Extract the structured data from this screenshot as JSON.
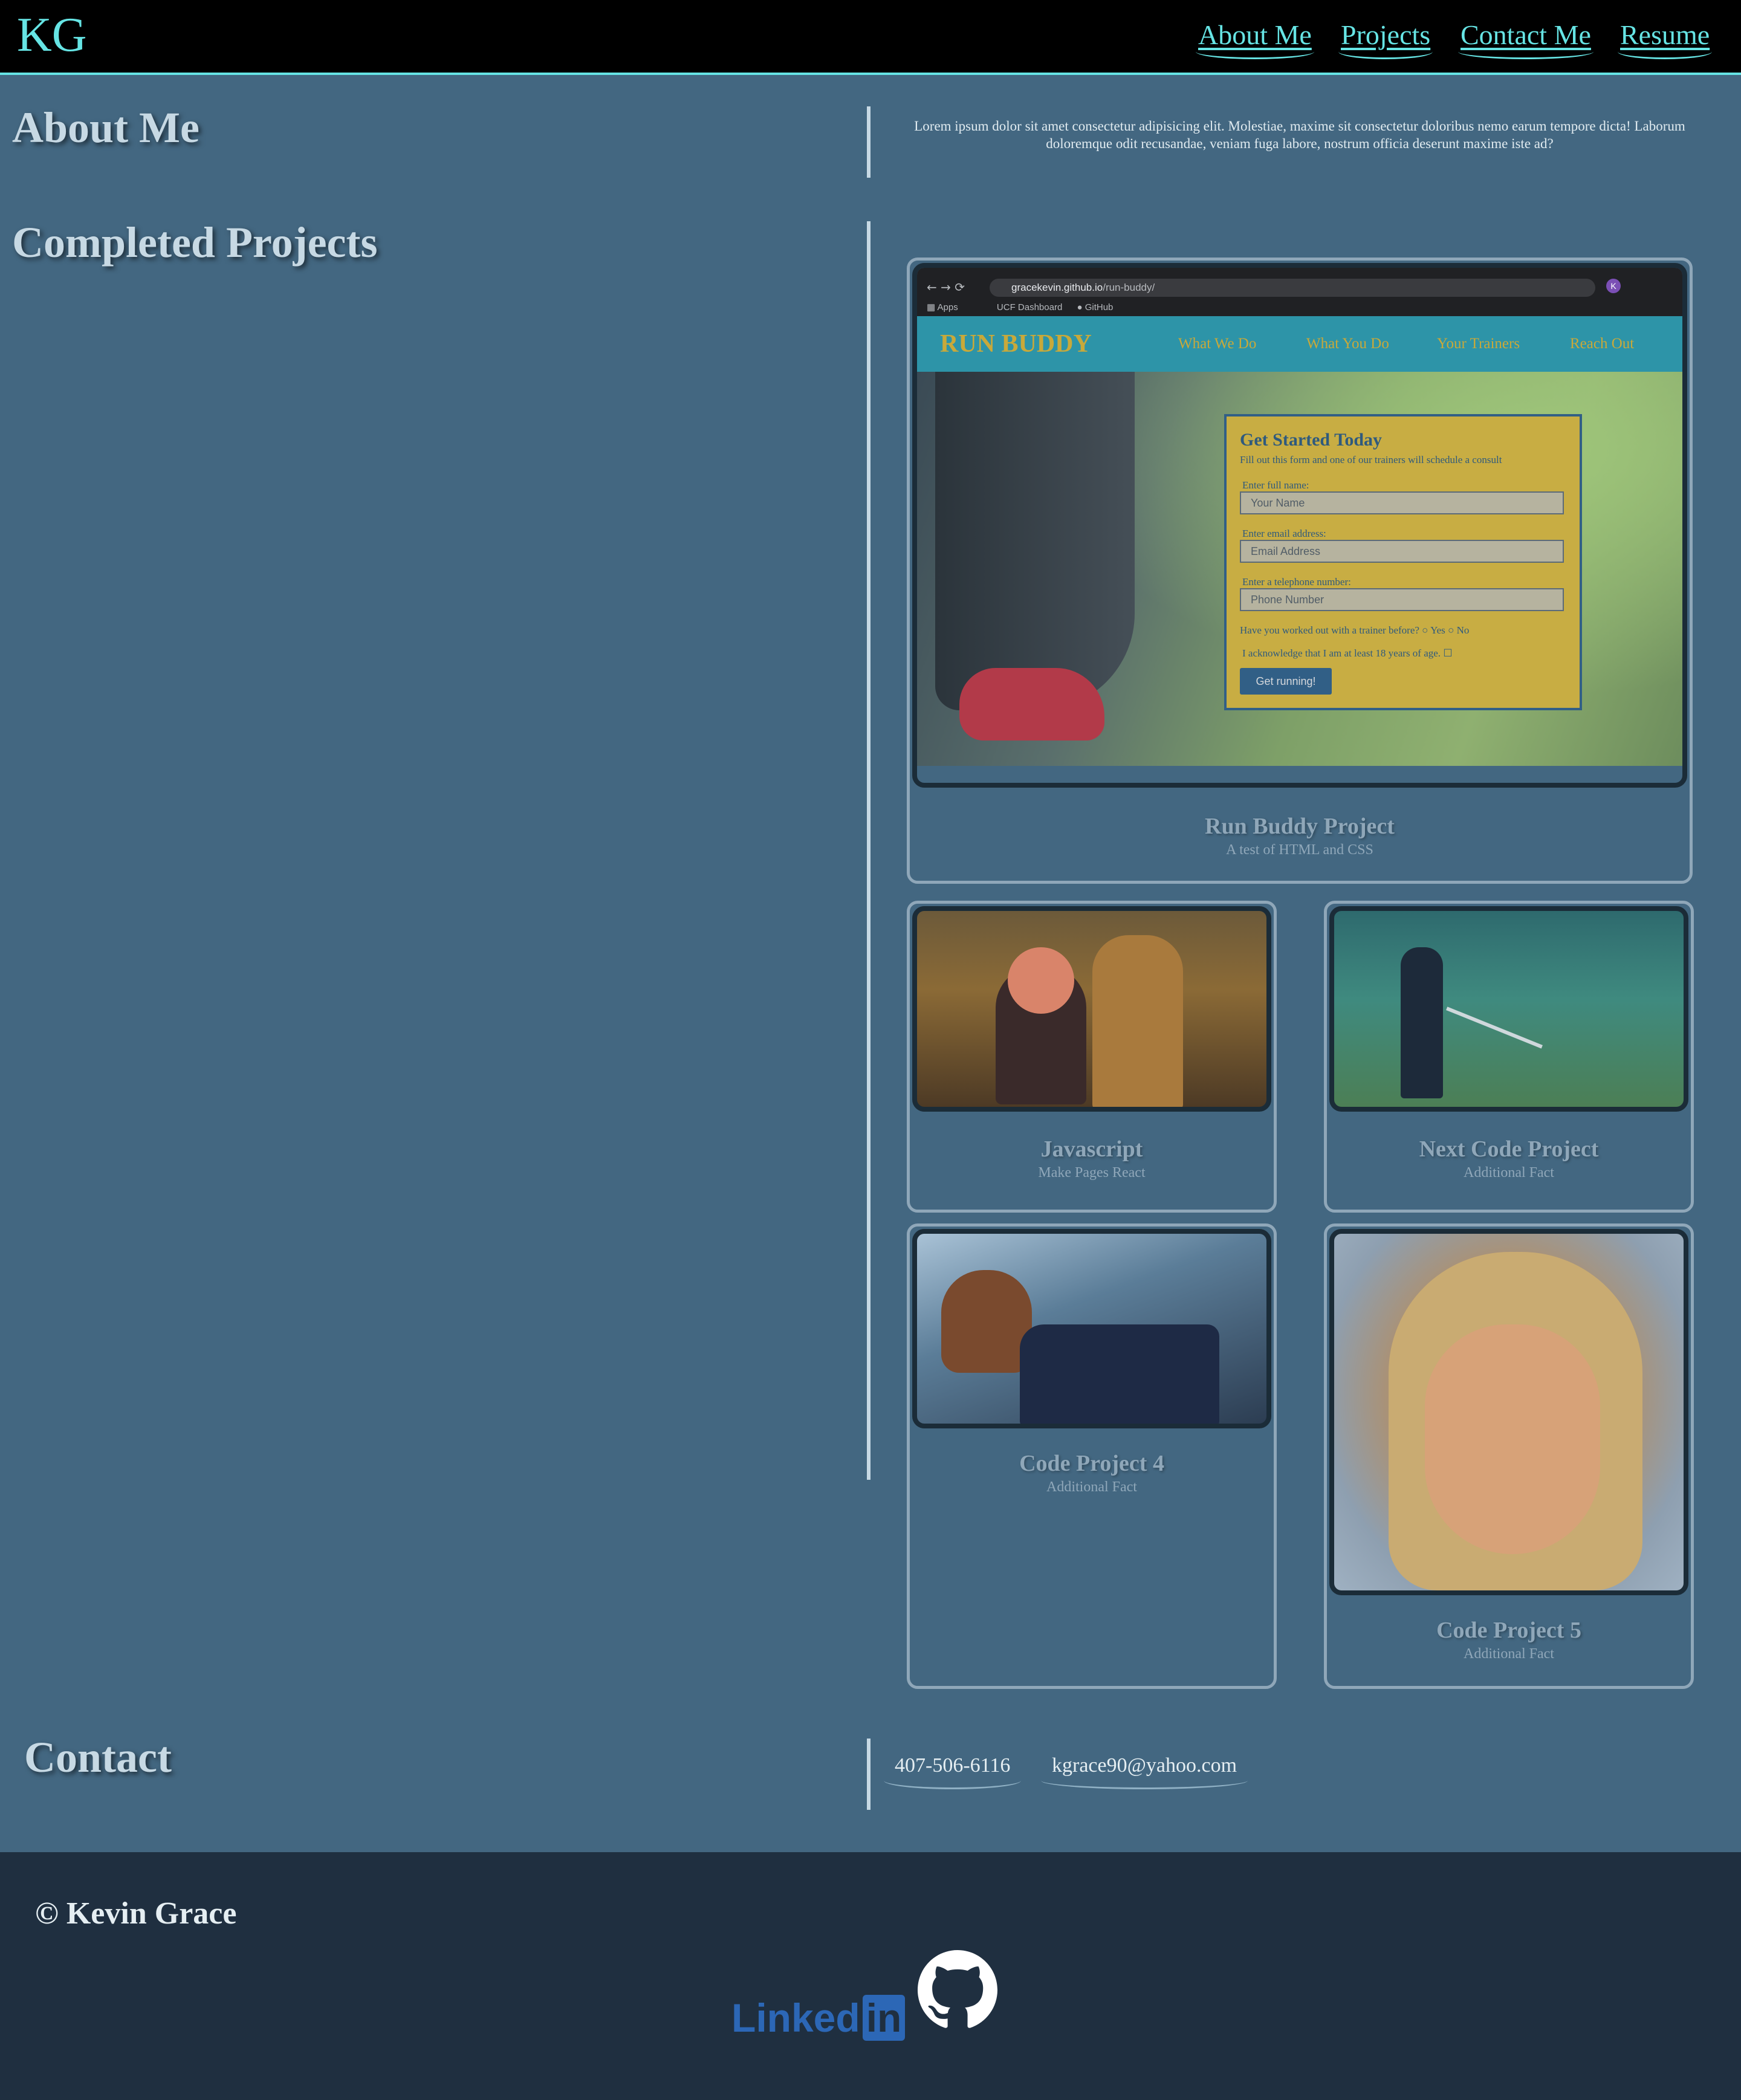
{
  "header": {
    "brand": "KG",
    "nav": [
      "About Me",
      "Projects",
      "Contact Me",
      "Resume"
    ]
  },
  "about": {
    "heading": "About Me",
    "text": "Lorem ipsum dolor sit amet consectetur adipisicing elit. Molestiae, maxime sit consectetur doloribus nemo earum tempore dicta! Laborum doloremque odit recusandae, veniam fuga labore, nostrum officia deserunt maxime iste ad?"
  },
  "projects": {
    "heading": "Completed Projects",
    "featured": {
      "title": "Run Buddy Project",
      "subtitle": "A test of HTML and CSS",
      "screenshot": {
        "url_host": "gracekevin.github.io",
        "url_path": "/run-buddy/",
        "bookmarks": [
          "Apps",
          "UCF Dashboard",
          "GitHub"
        ],
        "logo": "RUN BUDDY",
        "nav": [
          "What We Do",
          "What You Do",
          "Your Trainers",
          "Reach Out"
        ],
        "form": {
          "title": "Get Started Today",
          "intro": "Fill out this form and one of our trainers will schedule a consult",
          "name_label": "Enter full name:",
          "name_placeholder": "Your Name",
          "email_label": "Enter email address:",
          "email_placeholder": "Email Address",
          "phone_label": "Enter a telephone number:",
          "phone_placeholder": "Phone Number",
          "trainer_question": "Have you worked out with a trainer before?",
          "yes": "Yes",
          "no": "No",
          "ack": "I acknowledge that I am at least 18 years of age.",
          "button": "Get running!"
        }
      }
    },
    "cards": [
      {
        "title": "Javascript",
        "subtitle": "Make Pages React"
      },
      {
        "title": "Next Code Project",
        "subtitle": "Additional Fact"
      },
      {
        "title": "Code Project 4",
        "subtitle": "Additional Fact"
      },
      {
        "title": "Code Project 5",
        "subtitle": "Additional Fact"
      }
    ]
  },
  "contact": {
    "heading": "Contact",
    "phone": "407-506-6116",
    "email": "kgrace90@yahoo.com"
  },
  "footer": {
    "copyright": "© Kevin Grace",
    "linkedin_text": "Linked",
    "linkedin_box": "in"
  },
  "colors": {
    "accent": "#66e4e4",
    "background": "#436781",
    "footer": "#1f2f40"
  },
  "icons": [
    "linkedin-icon",
    "github-icon"
  ]
}
